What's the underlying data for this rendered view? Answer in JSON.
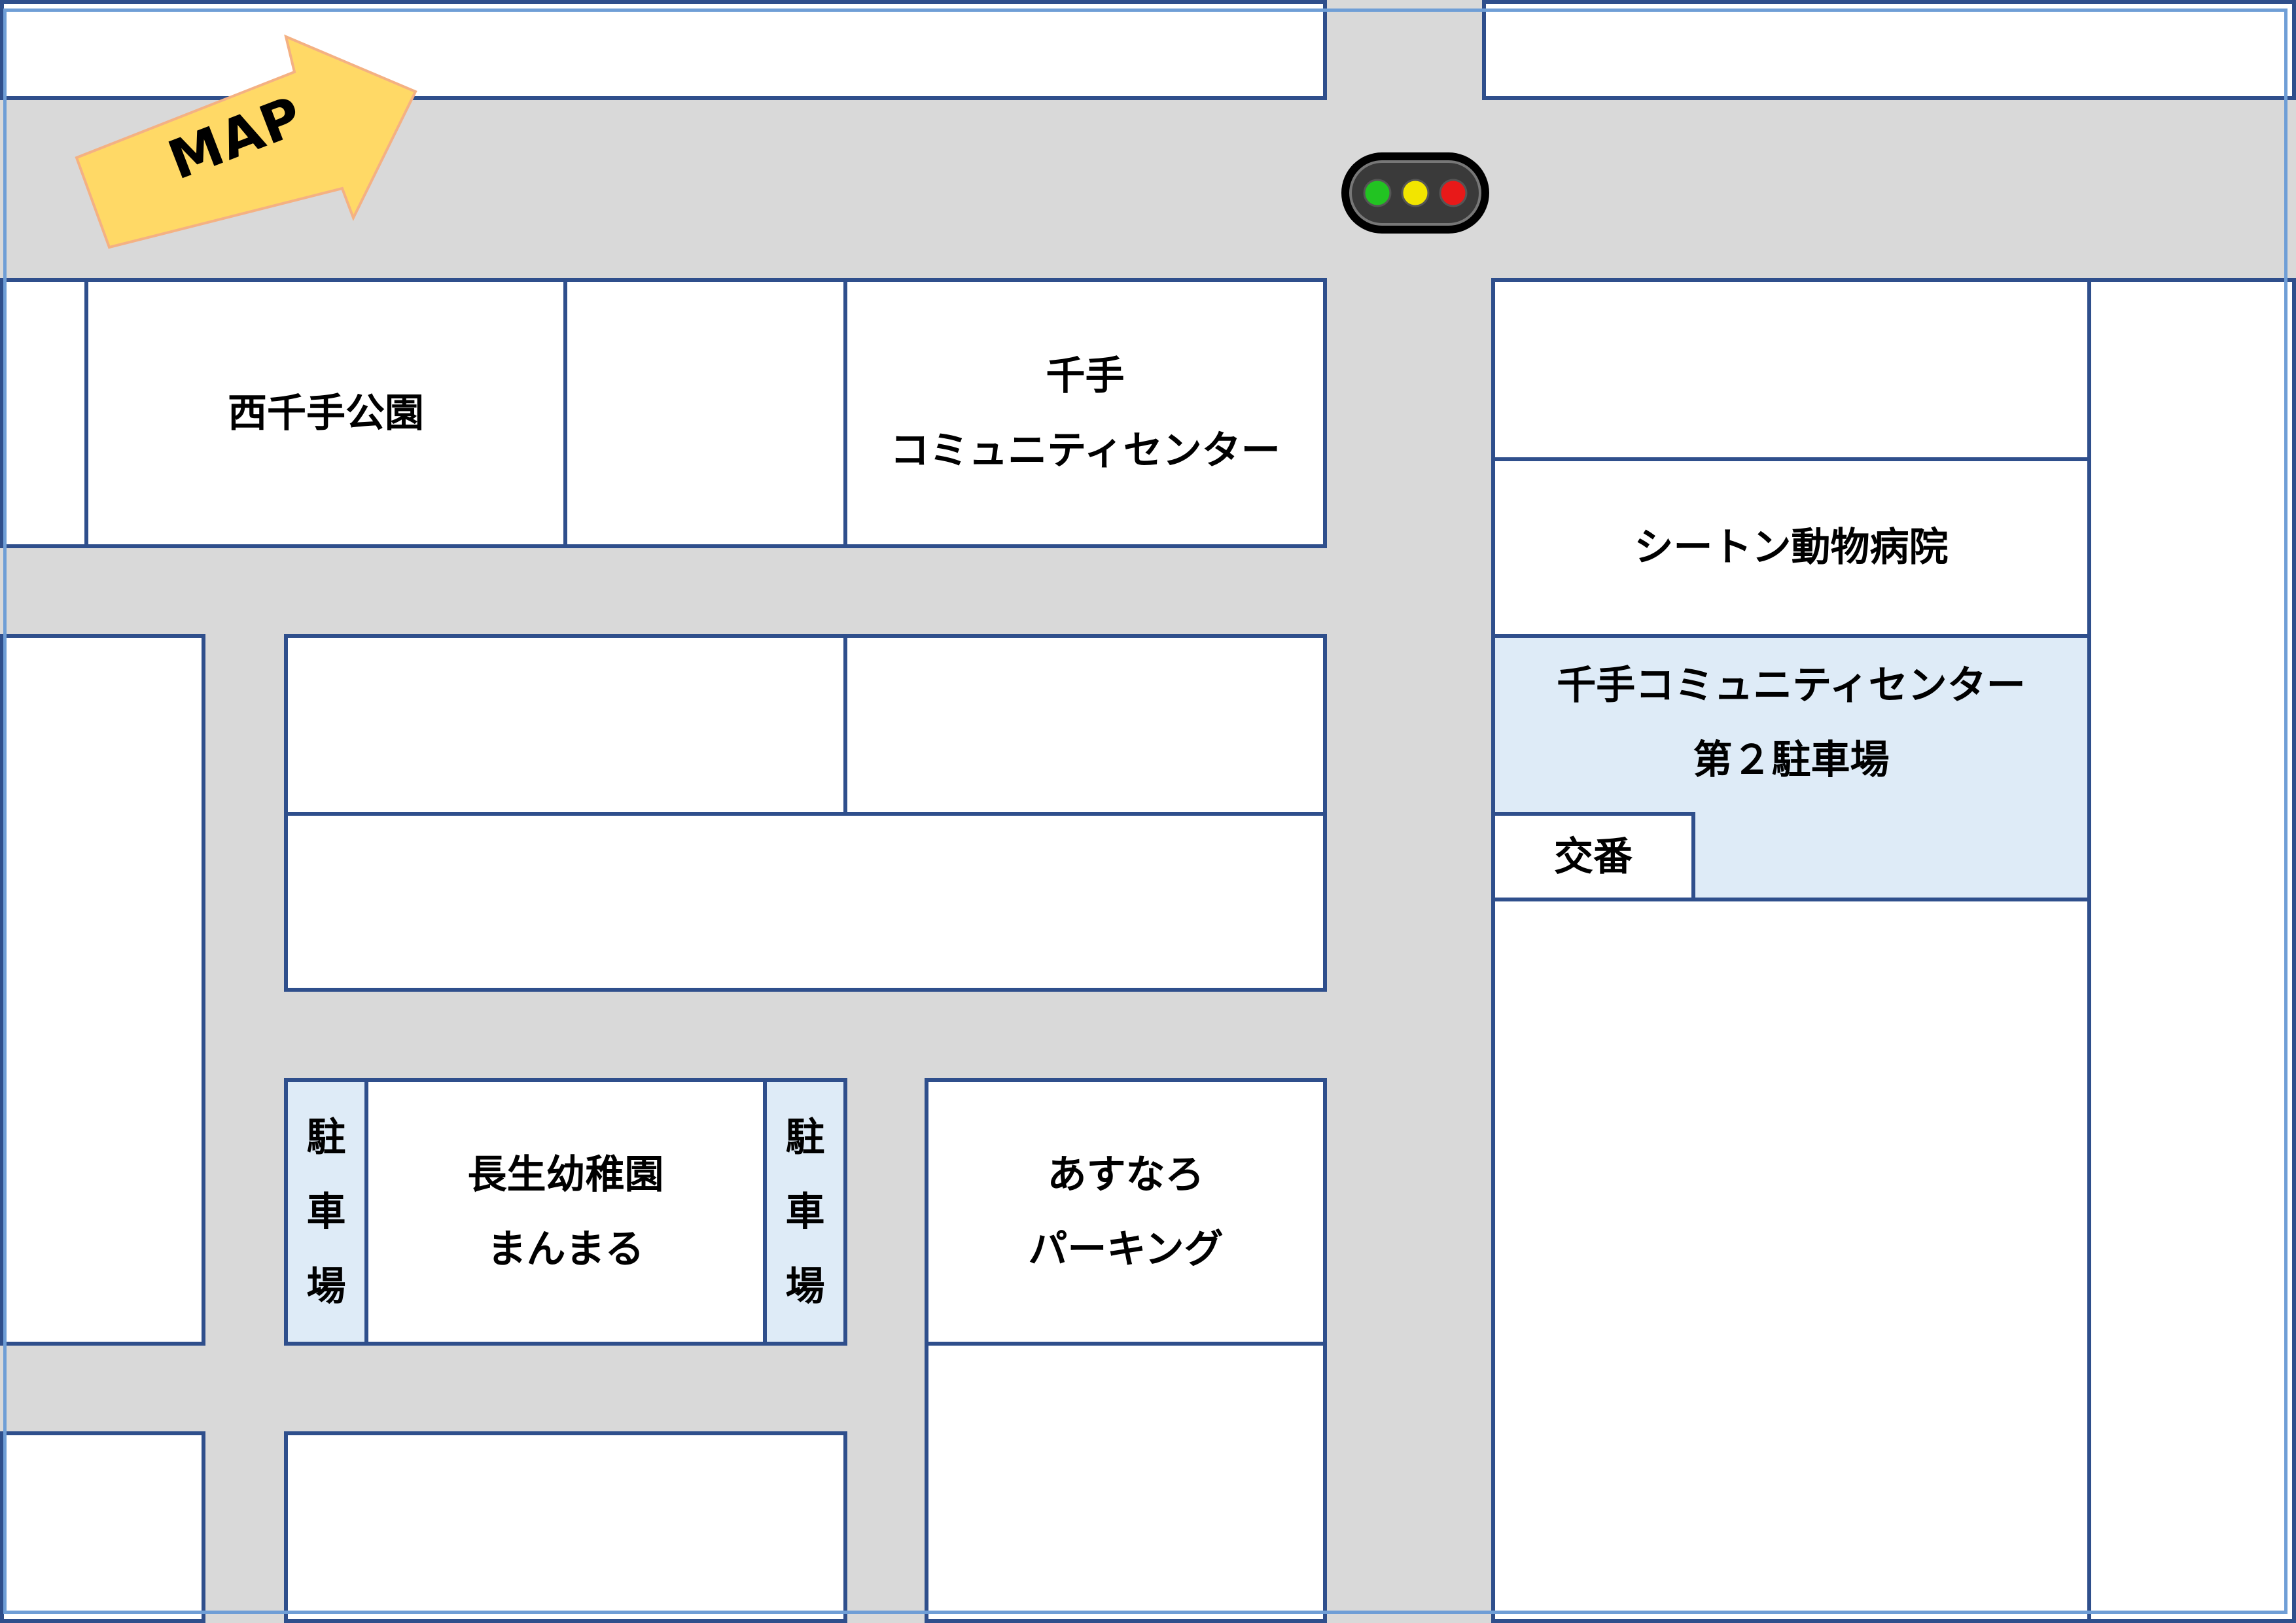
{
  "map_label": "MAP",
  "places": {
    "park": "西千手公園",
    "community_center_line1": "千手",
    "community_center_line2": "コミュニティセンター",
    "animal_hospital": "シートン動物病院",
    "parking2_line1": "千手コミュニティセンター",
    "parking2_line2": "第２駐車場",
    "police_box": "交番",
    "kindergarten_line1": "長生幼稚園",
    "kindergarten_line2": "まんまる",
    "parking_left": [
      "駐",
      "車",
      "場"
    ],
    "parking_right": [
      "駐",
      "車",
      "場"
    ],
    "asunaro_line1": "あすなろ",
    "asunaro_line2": "パーキング"
  },
  "colors": {
    "road": "#d9d9d9",
    "block_border": "#2f4f8c",
    "parking_fill": "#deebf7",
    "arrow_fill": "#ffd966",
    "arrow_stroke": "#f4b183",
    "signal_green": "#22c322",
    "signal_yellow": "#f2e500",
    "signal_red": "#e81919"
  },
  "icons": [
    "map-arrow-icon",
    "traffic-signal-icon"
  ]
}
